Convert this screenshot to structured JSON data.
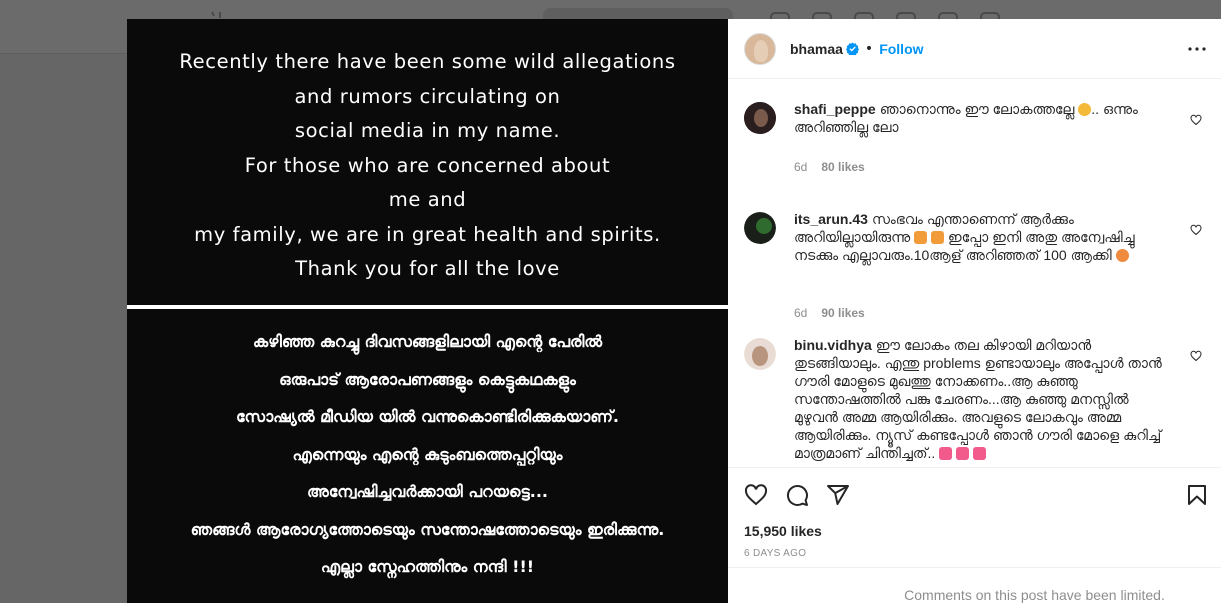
{
  "post": {
    "image_text_english": [
      "Recently there have been some wild allegations",
      "and rumors circulating on",
      "social media in my name.",
      "For those who are concerned about",
      "me and",
      "my family, we are in great health and spirits.",
      "Thank you for all the love"
    ],
    "image_text_malayalam": [
      "കഴിഞ്ഞ കുറച്ചു ദിവസങ്ങളിലായി എന്റെ പേരിൽ",
      "ഒരുപാട് ആരോപണങ്ങളും  കെട്ടുകഥകളും",
      "സോഷ്യൽ മീഡിയ യിൽ വന്നുകൊണ്ടിരിക്കുകയാണ്.",
      "എന്നെയും എന്റെ കുടുംബത്തെപ്പറ്റിയും",
      "അന്വേഷിച്ചവർക്കായി പറയട്ടെ...",
      "ഞങ്ങൾ ആരോഗ്യത്തോടെയും സന്തോഷത്തോടെയും ഇരിക്കുന്നു.",
      "എല്ലാ സ്നേഹത്തിനും നന്ദി !!!"
    ]
  },
  "header": {
    "username": "bhamaa",
    "separator": "•",
    "follow_label": "Follow",
    "verified_color": "#0095f6"
  },
  "comments": [
    {
      "username": "shafi_peppe",
      "text": "ഞാനൊന്നും ഈ ലോകത്തല്ലേ ",
      "text_after": ".. ഒന്നും അറിഞ്ഞില്ല ലോ",
      "age": "6d",
      "likes": "80 likes"
    },
    {
      "username": "its_arun.43",
      "text": "സംഭവം എന്താണെന്ന് ആർക്കും അറിയില്ലായിരുന്നു ",
      "text_mid": " ഇപ്പോ ഇനി അതു അന്വേഷിച്ചു നടക്കും എല്ലാവരും.10ആള് അറിഞ്ഞത് 100 ആക്കി ",
      "age": "6d",
      "likes": "90 likes"
    },
    {
      "username": "binu.vidhya",
      "text": "ഈ ലോകം തല കിഴായി മറിയാൻ തുടങ്ങിയാലും. എന്തു problems ഉണ്ടായാലും അപ്പോൾ താൻ ഗൗരി മോളുടെ മുഖത്തു നോക്കണം..ആ കുഞ്ഞു സന്തോഷത്തിൽ പങ്കു ചേരണം...ആ കുഞ്ഞു മനസ്സിൽ മുഴുവൻ അമ്മ ആയിരിക്കും. അവളുടെ ലോകവും അമ്മ ആയിരിക്കും. ന്യൂസ് കണ്ടപ്പോൾ ഞാൻ ഗൗരി മോളെ കുറിച്ച് മാത്രമാണ് ചിന്തിച്ചത്.. "
    }
  ],
  "footer": {
    "likes": "15,950 likes",
    "timestamp": "6 DAYS AGO",
    "comments_limited": "Comments on this post have been limited."
  },
  "icons": [
    "heart-icon",
    "comment-icon",
    "share-icon",
    "save-icon",
    "more-options-icon",
    "verified-badge-icon"
  ]
}
